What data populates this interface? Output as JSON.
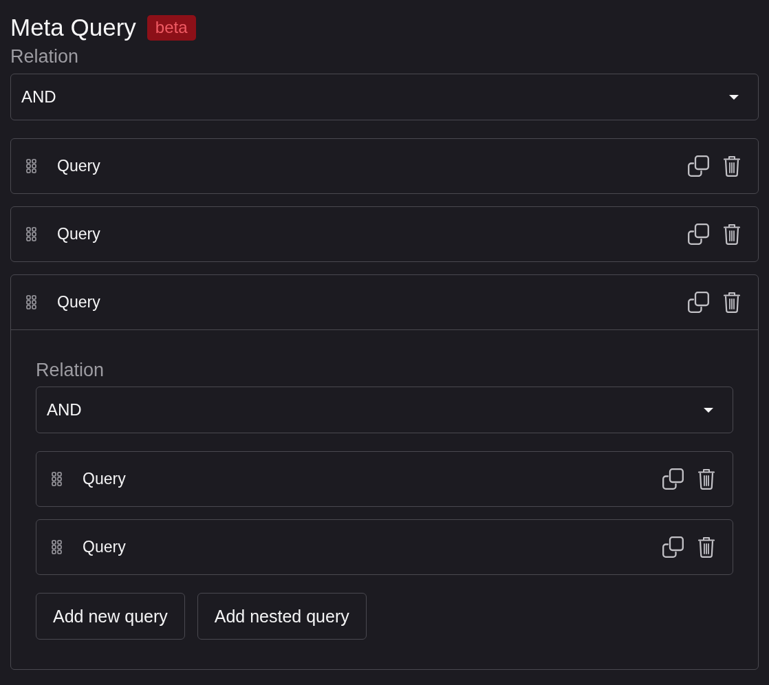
{
  "title": "Meta Query",
  "badge": "beta",
  "group": {
    "relation_label": "Relation",
    "relation": "AND",
    "queries": [
      {
        "label": "Query",
        "expanded": false
      },
      {
        "label": "Query",
        "expanded": false
      },
      {
        "label": "Query",
        "expanded": true,
        "group": {
          "relation_label": "Relation",
          "relation": "AND",
          "queries": [
            {
              "label": "Query",
              "expanded": false
            },
            {
              "label": "Query",
              "expanded": false
            }
          ],
          "buttons": [
            "Add new query",
            "Add nested query"
          ]
        }
      }
    ]
  }
}
